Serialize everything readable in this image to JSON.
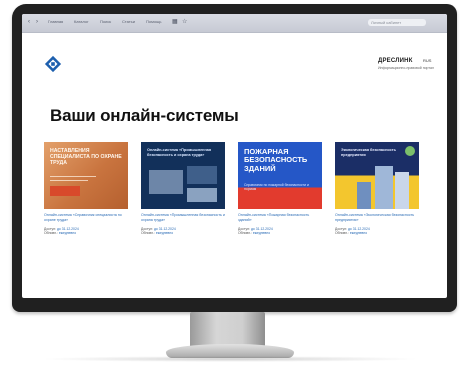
{
  "browser": {
    "tabs": [
      "Главная",
      "Каталог",
      "Поиск",
      "Статьи",
      "Помощь"
    ],
    "address": "Личный кабинет"
  },
  "site": {
    "brand": "ДРЕСЛИНК",
    "brand_sub": "Информационно-правовой портал",
    "lang": "RUS"
  },
  "page": {
    "title": "Ваши онлайн-системы"
  },
  "cards": [
    {
      "cover_title": "Наставления специалиста по охране труда",
      "link": "Онлайн-система «Справочник специалиста по охране труда»",
      "access_label": "Доступ:",
      "access_value": "до 31.12.2024",
      "update_label": "Обновл.:",
      "update_value": "ежедневно"
    },
    {
      "cover_title": "Онлайн-система «Промышленная безопасность и охрана труда»",
      "link": "Онлайн-система «Промышленная безопасность и охрана труда»",
      "access_label": "Доступ:",
      "access_value": "до 31.12.2024",
      "update_label": "Обновл.:",
      "update_value": "ежедневно"
    },
    {
      "cover_title": "Пожарная безопасность зданий",
      "cover_sub": "Справочник по пожарной безопасности и нормам",
      "link": "Онлайн-система «Пожарная безопасность зданий»",
      "access_label": "Доступ:",
      "access_value": "до 31.12.2024",
      "update_label": "Обновл.:",
      "update_value": "ежедневно"
    },
    {
      "cover_title": "Экологическая безопасность предприятия",
      "link": "Онлайн-система «Экологическая безопасность предприятия»",
      "access_label": "Доступ:",
      "access_value": "до 31.12.2024",
      "update_label": "Обновл.:",
      "update_value": "ежедневно"
    }
  ],
  "colors": {
    "accent": "#2a6bb5",
    "bezel": "#202020"
  }
}
